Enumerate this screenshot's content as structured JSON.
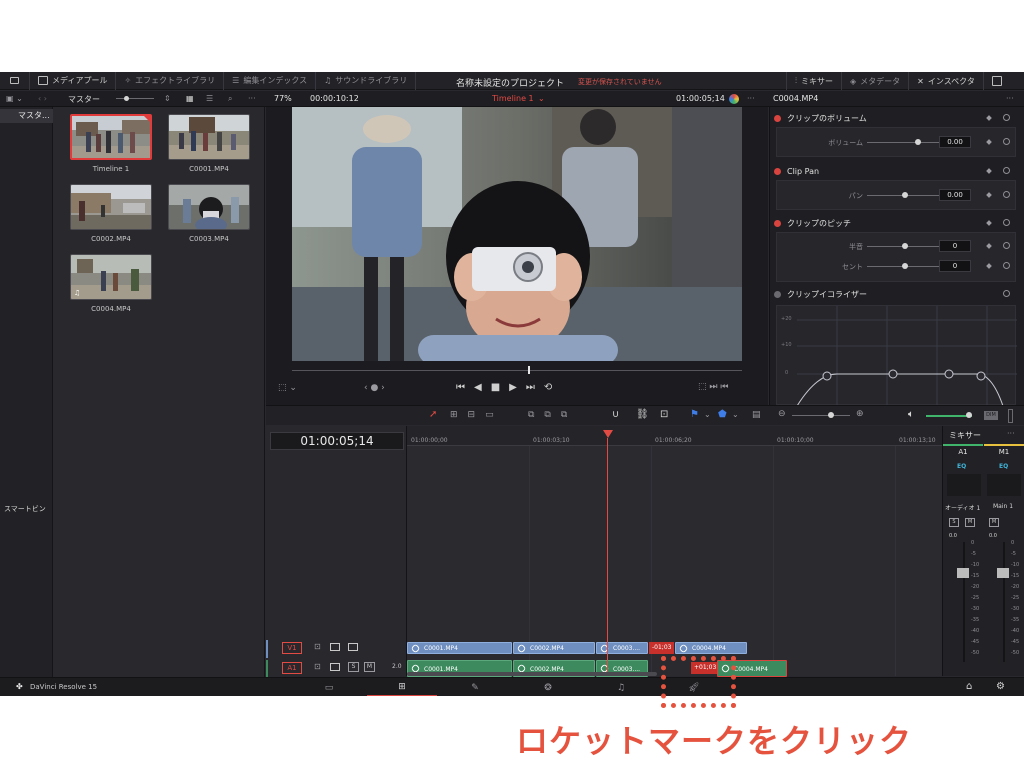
{
  "topbar": {
    "media_pool": "メディアプール",
    "effects_library": "エフェクトライブラリ",
    "edit_index": "編集インデックス",
    "sound_library": "サウンドライブラリ",
    "project_title": "名称未設定のプロジェクト",
    "save_status": "変更が保存されていません",
    "mixer": "ミキサー",
    "metadata": "メタデータ",
    "inspector": "インスペクタ"
  },
  "subbar": {
    "bin_name": "マスター",
    "zoom": "77%",
    "source_timecode": "00:00:10:12",
    "timeline_name": "Timeline 1",
    "record_timecode": "01:00:05;14",
    "clip_name": "C0004.MP4"
  },
  "bins": {
    "master": "マスタ...",
    "smart_bins": "スマートビン"
  },
  "media_pool": {
    "items": [
      {
        "label": "Timeline 1"
      },
      {
        "label": "C0001.MP4"
      },
      {
        "label": "C0002.MP4"
      },
      {
        "label": "C0003.MP4"
      },
      {
        "label": "C0004.MP4"
      }
    ]
  },
  "inspector": {
    "volume_section": "クリップのボリューム",
    "volume_label": "ボリューム",
    "volume_value": "0.00",
    "pan_section": "Clip Pan",
    "pan_label": "パン",
    "pan_value": "0.00",
    "pitch_section": "クリップのピッチ",
    "semitone_label": "半音",
    "semitone_value": "0",
    "cent_label": "セント",
    "cent_value": "0",
    "eq_section": "クリップイコライザー",
    "eq_labels": [
      "+20",
      "+10",
      "0"
    ]
  },
  "timeline": {
    "current_timecode": "01:00:05;14",
    "ruler": [
      "01:00:00;00",
      "01:00:03;10",
      "01:00:06;20",
      "01:00:10;00",
      "01:00:13;10"
    ],
    "video_track": "V1",
    "audio_track": "A1",
    "audio_level": "2.0",
    "solo": "S",
    "mute": "M",
    "video_clips": [
      "C0001.MP4",
      "C0002.MP4",
      "C0003....",
      "C0004.MP4"
    ],
    "audio_clips": [
      "C0001.MP4",
      "C0002.MP4",
      "C0003....",
      "C0004.MP4"
    ],
    "video_offset": "-01;03",
    "audio_offset": "+01;03"
  },
  "mixer": {
    "title": "ミキサー",
    "channels": [
      "A1",
      "M1"
    ],
    "eq": "EQ",
    "audio1": "オーディオ 1",
    "main1": "Main 1",
    "level": "0.0",
    "scale": [
      "0",
      "-5",
      "-10",
      "-15",
      "-20",
      "-25",
      "-30",
      "-35",
      "-40",
      "-45",
      "-50"
    ]
  },
  "bottombar": {
    "app_name": "DaVinci Resolve 15"
  },
  "annotation": {
    "text": "ロケットマークをクリック"
  },
  "colors": {
    "accent_red": "#d9443f",
    "annotation": "#e5533f",
    "video_clip": "#6e8fc0",
    "audio_clip": "#3d8a5f"
  }
}
